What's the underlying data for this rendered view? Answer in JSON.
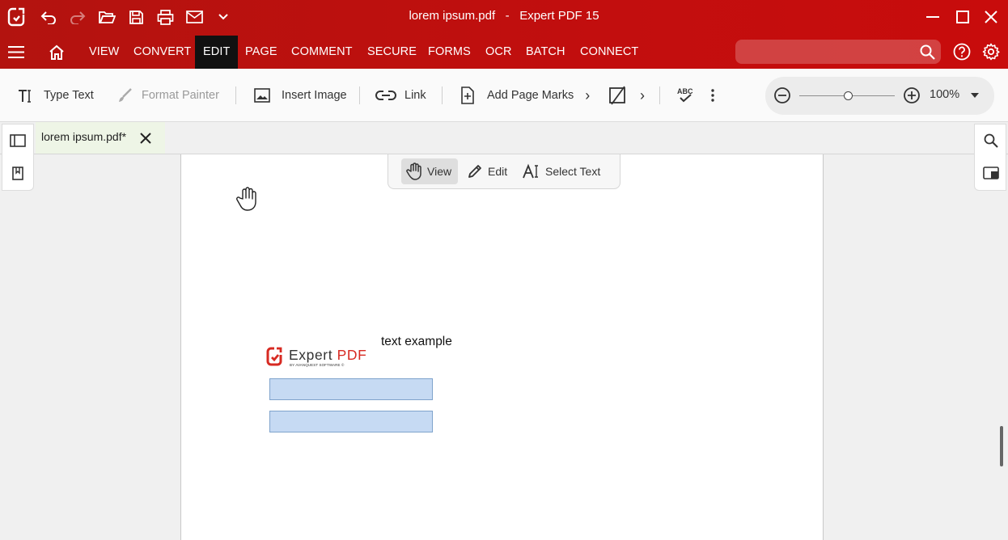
{
  "window": {
    "file_name": "lorem ipsum.pdf",
    "separator": "-",
    "app_name": "Expert PDF 15"
  },
  "quick_toolbar": {
    "icons": [
      "app-logo-icon",
      "undo-icon",
      "redo-icon",
      "open-folder-icon",
      "save-icon",
      "print-icon",
      "mail-icon",
      "chevron-down-icon"
    ]
  },
  "menu": {
    "items": [
      "VIEW",
      "CONVERT",
      "EDIT",
      "PAGE",
      "COMMENT",
      "SECURE",
      "FORMS",
      "OCR",
      "BATCH",
      "CONNECT"
    ],
    "active": "EDIT"
  },
  "search": {
    "placeholder": ""
  },
  "ribbon": {
    "type_text": "Type Text",
    "format_painter": "Format Painter",
    "insert_image": "Insert Image",
    "link": "Link",
    "add_page_marks": "Add Page Marks",
    "more_glyph": "›",
    "zoom": "100%"
  },
  "tab": {
    "label": "lorem ipsum.pdf*"
  },
  "modes": {
    "view": "View",
    "edit": "Edit",
    "select_text": "Select Text",
    "active": "View"
  },
  "document": {
    "text_example": "text example",
    "logo_word_main": "Expert",
    "logo_word_accent": "PDF",
    "logo_tagline": "BY AVANQUEST SOFTWARE ©",
    "form_fields": 2
  },
  "colors": {
    "brand_red": "#c20e0e",
    "active_menu": "#111111",
    "tab_bg": "#eef5e6",
    "field_fill": "#c6daf3",
    "logo_red": "#d72a22"
  }
}
